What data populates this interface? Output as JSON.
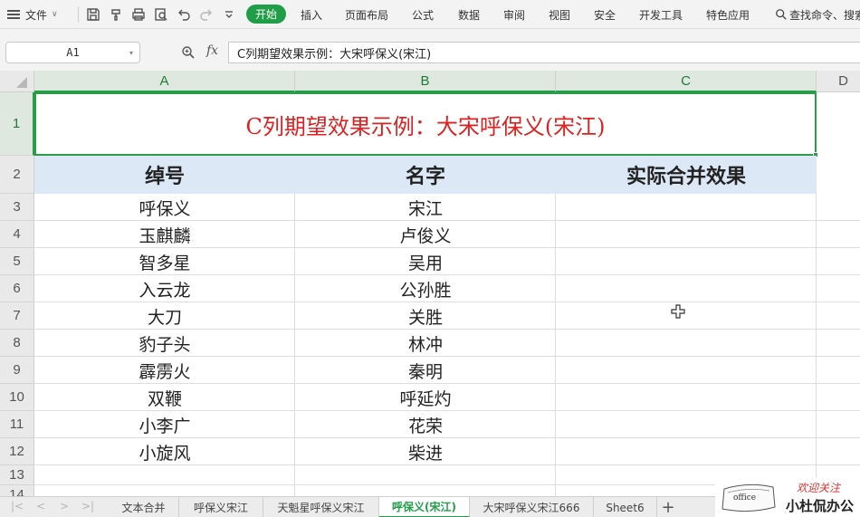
{
  "menubar": {
    "file_label": "文件",
    "tabs": [
      {
        "label": "开始",
        "active": true
      },
      {
        "label": "插入"
      },
      {
        "label": "页面布局"
      },
      {
        "label": "公式"
      },
      {
        "label": "数据"
      },
      {
        "label": "审阅"
      },
      {
        "label": "视图"
      },
      {
        "label": "安全"
      },
      {
        "label": "开发工具"
      },
      {
        "label": "特色应用"
      }
    ],
    "search_label": "查找命令、搜索"
  },
  "formula_bar": {
    "name_box": "A1",
    "formula": "C列期望效果示例：大宋呼保义(宋江)"
  },
  "grid": {
    "columns": [
      "A",
      "B",
      "C",
      "D"
    ],
    "rows": [
      "1",
      "2",
      "3",
      "4",
      "5",
      "6",
      "7",
      "8",
      "9",
      "10",
      "11",
      "12",
      "13",
      "14"
    ],
    "title": "C列期望效果示例：大宋呼保义(宋江)",
    "header": {
      "a": "绰号",
      "b": "名字",
      "c": "实际合并效果"
    },
    "data_rows": [
      {
        "a": "呼保义",
        "b": "宋江"
      },
      {
        "a": "玉麒麟",
        "b": "卢俊义"
      },
      {
        "a": "智多星",
        "b": "吴用"
      },
      {
        "a": "入云龙",
        "b": "公孙胜"
      },
      {
        "a": "大刀",
        "b": "关胜"
      },
      {
        "a": "豹子头",
        "b": "林冲"
      },
      {
        "a": "霹雳火",
        "b": "秦明"
      },
      {
        "a": "双鞭",
        "b": "呼延灼"
      },
      {
        "a": "小李广",
        "b": "花荣"
      },
      {
        "a": "小旋风",
        "b": "柴进"
      }
    ],
    "colors": {
      "title_text": "#e02020",
      "header_fill": "#dce8f5",
      "selection": "#2f9b48"
    }
  },
  "sheets": {
    "tabs": [
      "文本合并",
      "呼保义宋江",
      "天魁星呼保义宋江",
      "呼保义(宋江)",
      "大宋呼保义宋江666",
      "Sheet6"
    ],
    "active_index": 3,
    "add_label": "+"
  },
  "watermark": {
    "tagline": "欢迎关注",
    "name": "小杜侃办公",
    "logo_text": "office"
  }
}
